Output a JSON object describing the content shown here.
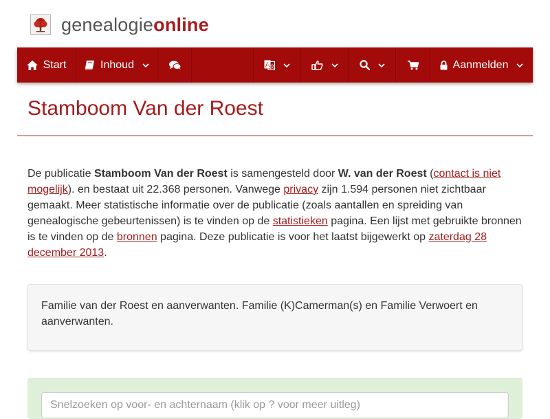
{
  "brand": {
    "name_part1": "genealogie",
    "name_part2": "online",
    "logo_icon": "tree-icon"
  },
  "nav": {
    "start_label": "Start",
    "start_icon": "home-icon",
    "inhoud_label": "Inhoud",
    "inhoud_icon": "book-icon",
    "forum_icon": "comments-icon",
    "language_icon": "language-icon",
    "share_icon": "share-icon",
    "search_icon": "search-icon",
    "cart_icon": "cart-icon",
    "login_label": "Aanmelden",
    "login_icon": "lock-icon",
    "chevron_icon": "chevron-down-icon"
  },
  "page": {
    "title": "Stamboom Van der Roest"
  },
  "intro": {
    "t1": "De publicatie ",
    "publication": "Stamboom Van der Roest",
    "t2": " is samengesteld door ",
    "author": "W. van der Roest",
    "t3": " (",
    "contact_link": "contact is niet mogelijk",
    "t4": "). en bestaat uit 22.368 personen. Vanwege ",
    "privacy_link": "privacy",
    "t5": " zijn 1.594 personen niet zichtbaar gemaakt. Meer statistische informatie over de publicatie (zoals aantallen en spreiding van genealogische gebeurtenissen) is te vinden op de ",
    "stats_link": "statistieken",
    "t6": " pagina. Een lijst met gebruikte bronnen is te vinden op de ",
    "sources_link": "bronnen",
    "t7": " pagina. Deze publicatie is voor het laatst bijgewerkt op ",
    "date_link": "zaterdag 28 december 2013",
    "t8": "."
  },
  "description": "Familie van der Roest en aanverwanten. Familie (K)Camerman(s) en Familie Verwoert en aanverwanten.",
  "quicksearch": {
    "placeholder": "Snelzoeken op voor- en achternaam (klik op ? voor meer uitleg)",
    "value": ""
  },
  "colors": {
    "brand_red": "#a30b0b",
    "link_red": "#a51c1c",
    "panel_green": "#dff0d8",
    "box_grey": "#f6f6f6"
  }
}
